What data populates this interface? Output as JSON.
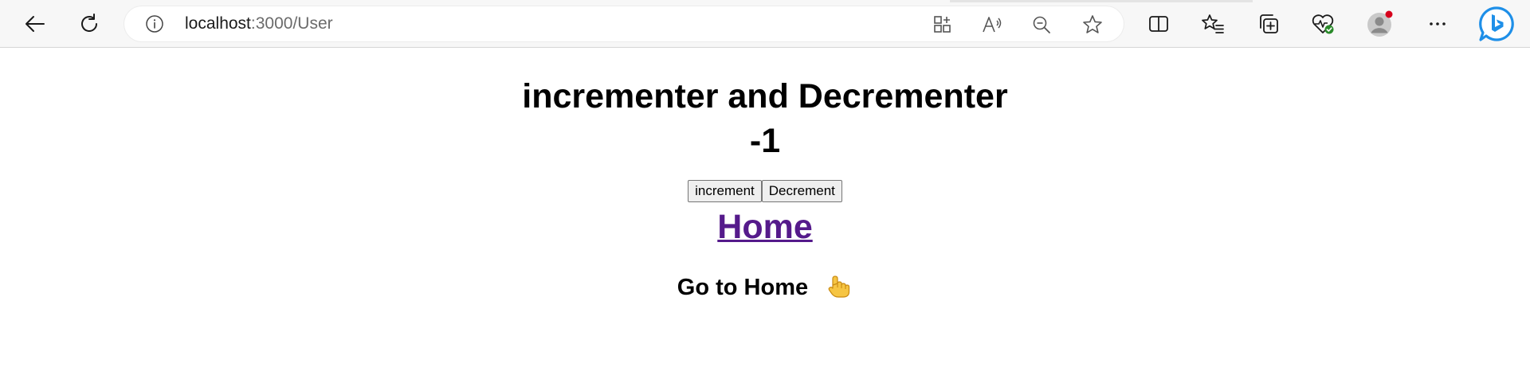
{
  "browser": {
    "url_host": "localhost",
    "url_path": ":3000/User"
  },
  "page": {
    "title": "incrementer and Decrementer",
    "count": "-1",
    "increment_label": "increment",
    "decrement_label": "Decrement",
    "home_link": "Home",
    "go_home_text": "Go to Home"
  },
  "colors": {
    "link_visited": "#551a8b",
    "toolbar_bg": "#f7f7f7",
    "profile_badge": "#d6001c",
    "bing_blue": "#1e90ff"
  },
  "icons": {
    "back": "back-arrow-icon",
    "refresh": "refresh-icon",
    "info": "info-icon",
    "apps": "apps-icon",
    "read_aloud": "read-aloud-icon",
    "zoom_out": "zoom-out-icon",
    "favorite": "star-icon",
    "split_screen": "split-screen-icon",
    "favorites": "favorites-icon",
    "collections": "collections-icon",
    "browser_essentials": "browser-essentials-icon",
    "profile": "profile-icon",
    "more": "more-icon",
    "bing": "bing-copilot-icon",
    "pointing_hand": "pointing-hand-icon"
  }
}
